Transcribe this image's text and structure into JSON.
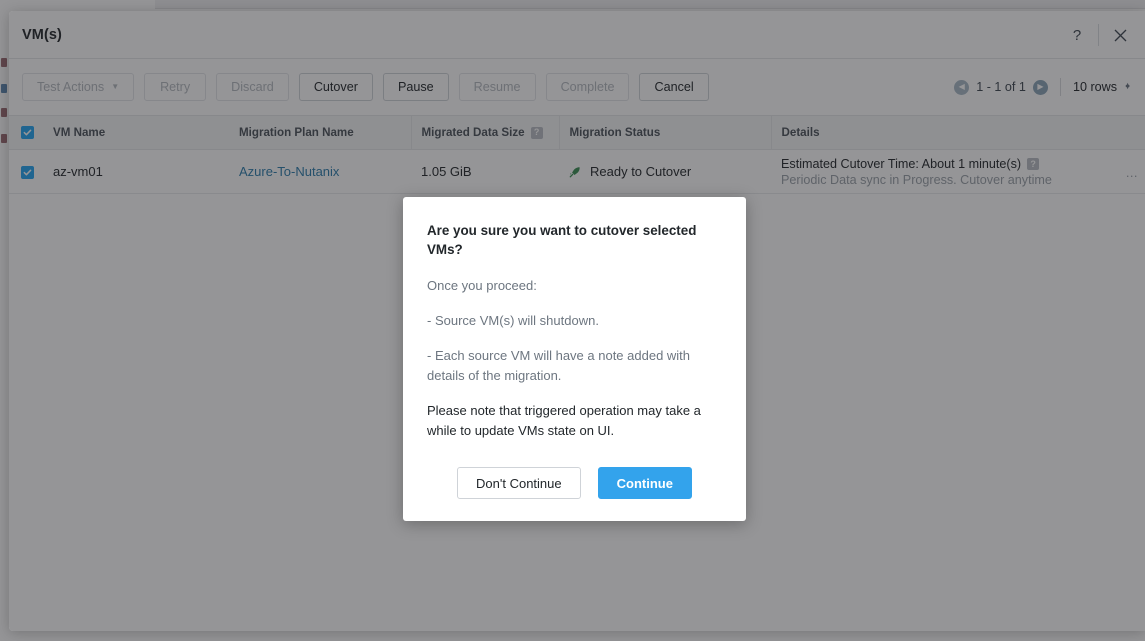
{
  "panel": {
    "title": "VM(s)",
    "help_icon_label": "?",
    "close_icon_label": "×"
  },
  "toolbar": {
    "buttons": [
      {
        "label": "Test Actions",
        "disabled": true,
        "caret": true
      },
      {
        "label": "Retry",
        "disabled": true,
        "caret": false
      },
      {
        "label": "Discard",
        "disabled": true,
        "caret": false
      },
      {
        "label": "Cutover",
        "disabled": false,
        "caret": false
      },
      {
        "label": "Pause",
        "disabled": false,
        "caret": false
      },
      {
        "label": "Resume",
        "disabled": true,
        "caret": false
      },
      {
        "label": "Complete",
        "disabled": true,
        "caret": false
      },
      {
        "label": "Cancel",
        "disabled": false,
        "caret": false
      }
    ],
    "pagination": {
      "prev_icon": "chevron-left",
      "next_icon": "chevron-right",
      "range_label": "1 - 1 of 1"
    },
    "rows_per_page": "10 rows"
  },
  "table": {
    "columns": [
      {
        "label": "VM Name",
        "help": false
      },
      {
        "label": "Migration Plan Name",
        "help": false
      },
      {
        "label": "Migrated Data Size",
        "help": true
      },
      {
        "label": "Migration Status",
        "help": false
      },
      {
        "label": "Details",
        "help": false
      }
    ],
    "help_badge_label": "?",
    "rows": [
      {
        "selected": true,
        "vm_name": "az-vm01",
        "migration_plan_name": "Azure-To-Nutanix",
        "migrated_data_size": "1.05 GiB",
        "migration_status": "Ready to Cutover",
        "status_icon": "green-rocket-icon",
        "details_main": "Estimated Cutover Time: About 1 minute(s)",
        "details_sub": "Periodic Data sync in Progress. Cutover anytime",
        "details_ellipsis": "…"
      }
    ]
  },
  "confirm_modal": {
    "title": "Are you sure you want to cutover selected VMs?",
    "paragraphs": [
      {
        "text": "Once you proceed:",
        "emphasis": false
      },
      {
        "text": "- Source VM(s) will shutdown.",
        "emphasis": false
      },
      {
        "text": "- Each source VM will have a note added with details of the migration.",
        "emphasis": false
      },
      {
        "text": "Please note that triggered operation may take a while to update VMs state on UI.",
        "emphasis": true
      }
    ],
    "cancel_label": "Don't Continue",
    "confirm_label": "Continue"
  },
  "colors": {
    "accent_blue": "#33a3ec",
    "checkbox_blue": "#22a5f1",
    "link_blue": "#2d7dad",
    "status_green": "#3a8f53",
    "overlay": "rgba(30,30,34,0.47)"
  }
}
